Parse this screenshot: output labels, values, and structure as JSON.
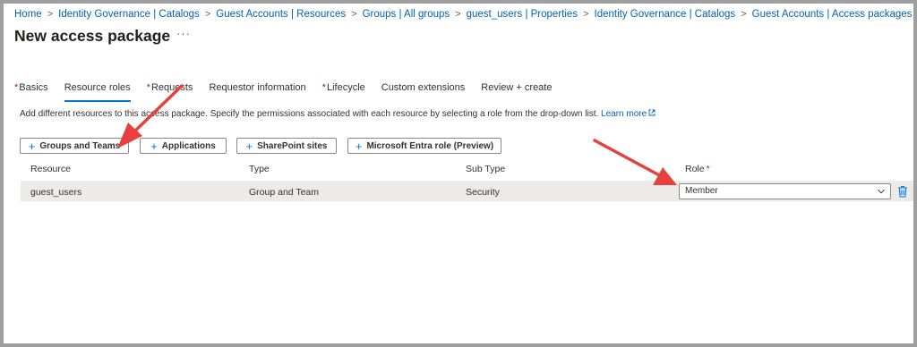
{
  "breadcrumb": {
    "items": [
      "Home",
      "Identity Governance | Catalogs",
      "Guest Accounts | Resources",
      "Groups | All groups",
      "guest_users | Properties",
      "Identity Governance | Catalogs",
      "Guest Accounts | Access packages"
    ],
    "separator": ">"
  },
  "page": {
    "title": "New access package",
    "more": "···"
  },
  "tabs": [
    {
      "label": "Basics",
      "required": true
    },
    {
      "label": "Resource roles",
      "required": false,
      "active": true
    },
    {
      "label": "Requests",
      "required": true
    },
    {
      "label": "Requestor information",
      "required": false
    },
    {
      "label": "Lifecycle",
      "required": true
    },
    {
      "label": "Custom extensions",
      "required": false
    },
    {
      "label": "Review + create",
      "required": false
    }
  ],
  "required_marker": "*",
  "description": {
    "text": "Add different resources to this access package. Specify the permissions associated with each resource by selecting a role from the drop-down list.",
    "link": "Learn more"
  },
  "buttons": {
    "plus": "+",
    "groups_teams": "Groups and Teams",
    "applications": "Applications",
    "sharepoint": "SharePoint sites",
    "entra_role": "Microsoft Entra role (Preview)"
  },
  "table": {
    "headers": {
      "resource": "Resource",
      "type": "Type",
      "subtype": "Sub Type",
      "role": "Role"
    },
    "rows": [
      {
        "resource": "guest_users",
        "type": "Group and Team",
        "subtype": "Security",
        "role": "Member"
      }
    ]
  },
  "colors": {
    "accent": "#0078d4",
    "link": "#0063b1",
    "required": "#a4262c",
    "annotation_arrow": "#e8403c",
    "row_bg": "#edebe9"
  },
  "icons": {
    "more": "more-icon",
    "plus": "plus-icon",
    "external": "external-link-icon",
    "chevron": "chevron-down-icon",
    "delete": "trash-icon",
    "annotation": "red-arrow"
  }
}
